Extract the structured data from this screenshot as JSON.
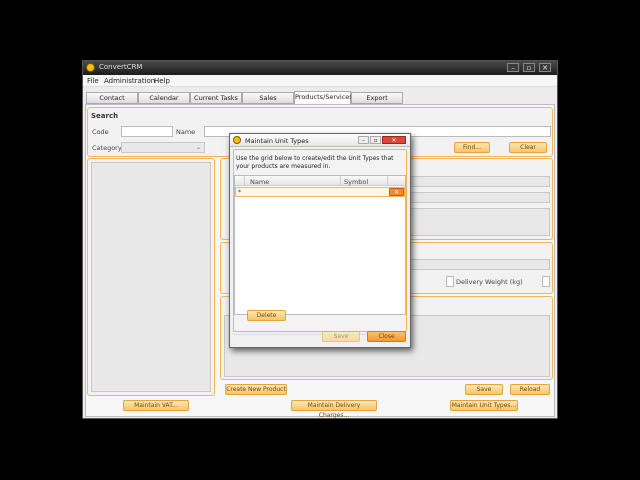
{
  "app": {
    "title": "ConvertCRM",
    "menus": [
      "File",
      "Administration",
      "Help"
    ],
    "tabs": [
      "Contact",
      "Calendar",
      "Current Tasks",
      "Sales",
      "Products/Services",
      "Export"
    ],
    "active_tab": "Products/Services"
  },
  "search": {
    "heading": "Search",
    "code_label": "Code",
    "name_label": "Name",
    "category_label": "Category",
    "find_button": "Find...",
    "clear_button": "Clear"
  },
  "details": {
    "delivery_weight_label": "Delivery Weight (kg)"
  },
  "actions": {
    "create_product": "Create New Product",
    "save": "Save",
    "reload": "Reload",
    "maintain_vat": "Maintain VAT...",
    "maintain_delivery": "Maintain Delivery Charges...",
    "maintain_units": "Maintain Unit Types..."
  },
  "dialog": {
    "title": "Maintain Unit Types",
    "instructions": "Use the grid below to create/edit the Unit Types that your products are measured in.",
    "col_name": "Name",
    "col_symbol": "Symbol",
    "new_row_marker": "*",
    "delete_button": "Delete",
    "save_button": "Save",
    "close_button": "Close"
  },
  "colors": {
    "accent_orange": "#f9c46c",
    "border_orange": "#f3b45a",
    "titlebar_dark": "#1c1c1c"
  }
}
